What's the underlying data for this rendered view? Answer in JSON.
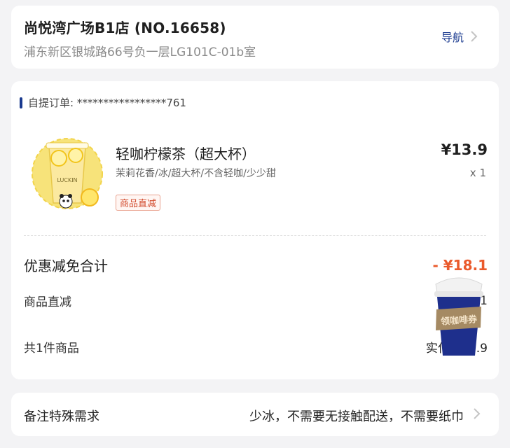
{
  "store": {
    "name": "尚悦湾广场B1店 (NO.16658)",
    "address": "浦东新区银城路66号负一层LG101C-01b室",
    "nav_label": "导航"
  },
  "order": {
    "pickup_label": "自提订单: *****************761",
    "product": {
      "name": "轻咖柠檬茶（超大杯）",
      "specs": "茉莉花香/冰/超大杯/不含轻咖/少少甜",
      "tag": "商品直减",
      "price": "¥13.9",
      "qty": "x 1",
      "cup_brand": "LUCKIN"
    },
    "discount_total_label": "优惠减免合计",
    "discount_total_value": "- ¥18.1",
    "direct_discount_label": "商品直减",
    "direct_discount_value": "-¥18.1",
    "total_items_label": "共1件商品",
    "paid_label": "实付 ¥13.9"
  },
  "coupon": {
    "label": "领咖啡券"
  },
  "notes": {
    "label": "备注特殊需求",
    "value": "少冰，不需要无接触配送，不需要纸巾"
  },
  "colors": {
    "brand_blue": "#1a3a8f",
    "discount_orange": "#ea5a2c",
    "background": "#f3f3f5"
  }
}
